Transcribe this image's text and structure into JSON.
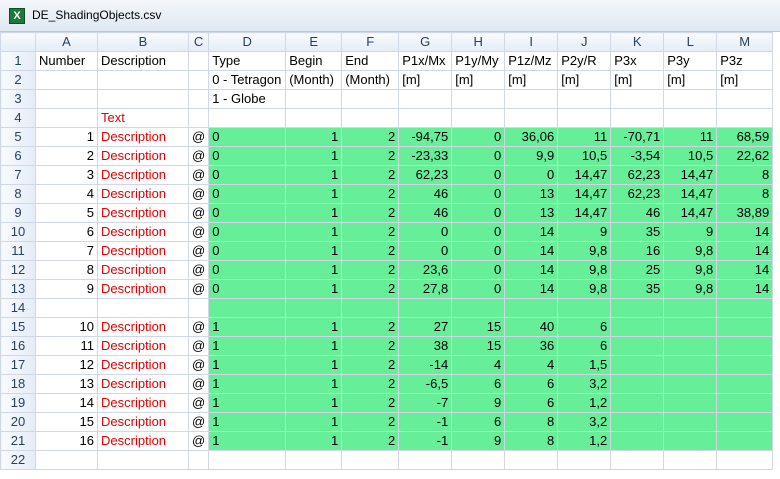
{
  "window": {
    "title": "DE_ShadingObjects.csv",
    "icon": "excel-icon"
  },
  "colors": {
    "fill": "#66ee99",
    "red_text": "#e00000"
  },
  "columns": [
    "A",
    "B",
    "C",
    "D",
    "E",
    "F",
    "G",
    "H",
    "I",
    "J",
    "K",
    "L",
    "M"
  ],
  "rows": [
    {
      "n": "1",
      "cells": [
        "Number",
        "Description",
        "",
        "Type",
        "Begin",
        "End",
        "P1x/Mx",
        "P1y/My",
        "P1z/Mz",
        "P2y/R",
        "P3x",
        "P3y",
        "P3z"
      ]
    },
    {
      "n": "2",
      "cells": [
        "",
        "",
        "",
        "0 - Tetragon",
        "(Month)",
        "(Month)",
        "[m]",
        "[m]",
        "[m]",
        "[m]",
        "[m]",
        "[m]",
        "[m]"
      ]
    },
    {
      "n": "3",
      "cells": [
        "",
        "",
        "",
        "1 - Globe",
        "",
        "",
        "",
        "",
        "",
        "",
        "",
        "",
        ""
      ]
    },
    {
      "n": "4",
      "cells": [
        "",
        "Text",
        "",
        "",
        "",
        "",
        "",
        "",
        "",
        "",
        "",
        "",
        ""
      ]
    },
    {
      "n": "5",
      "cells": [
        "1",
        "Description",
        "@",
        "0",
        "1",
        "2",
        "-94,75",
        "0",
        "36,06",
        "11",
        "-70,71",
        "11",
        "68,59"
      ]
    },
    {
      "n": "6",
      "cells": [
        "2",
        "Description",
        "@",
        "0",
        "1",
        "2",
        "-23,33",
        "0",
        "9,9",
        "10,5",
        "-3,54",
        "10,5",
        "22,62"
      ]
    },
    {
      "n": "7",
      "cells": [
        "3",
        "Description",
        "@",
        "0",
        "1",
        "2",
        "62,23",
        "0",
        "0",
        "14,47",
        "62,23",
        "14,47",
        "8"
      ]
    },
    {
      "n": "8",
      "cells": [
        "4",
        "Description",
        "@",
        "0",
        "1",
        "2",
        "46",
        "0",
        "13",
        "14,47",
        "62,23",
        "14,47",
        "8"
      ]
    },
    {
      "n": "9",
      "cells": [
        "5",
        "Description",
        "@",
        "0",
        "1",
        "2",
        "46",
        "0",
        "13",
        "14,47",
        "46",
        "14,47",
        "38,89"
      ]
    },
    {
      "n": "10",
      "cells": [
        "6",
        "Description",
        "@",
        "0",
        "1",
        "2",
        "0",
        "0",
        "14",
        "9",
        "35",
        "9",
        "14"
      ]
    },
    {
      "n": "11",
      "cells": [
        "7",
        "Description",
        "@",
        "0",
        "1",
        "2",
        "0",
        "0",
        "14",
        "9,8",
        "16",
        "9,8",
        "14"
      ]
    },
    {
      "n": "12",
      "cells": [
        "8",
        "Description",
        "@",
        "0",
        "1",
        "2",
        "23,6",
        "0",
        "14",
        "9,8",
        "25",
        "9,8",
        "14"
      ]
    },
    {
      "n": "13",
      "cells": [
        "9",
        "Description",
        "@",
        "0",
        "1",
        "2",
        "27,8",
        "0",
        "14",
        "9,8",
        "35",
        "9,8",
        "14"
      ]
    },
    {
      "n": "14",
      "cells": [
        "",
        "",
        "",
        "",
        "",
        "",
        "",
        "",
        "",
        "",
        "",
        "",
        ""
      ]
    },
    {
      "n": "15",
      "cells": [
        "10",
        "Description",
        "@",
        "1",
        "1",
        "2",
        "27",
        "15",
        "40",
        "6",
        "",
        "",
        ""
      ]
    },
    {
      "n": "16",
      "cells": [
        "11",
        "Description",
        "@",
        "1",
        "1",
        "2",
        "38",
        "15",
        "36",
        "6",
        "",
        "",
        ""
      ]
    },
    {
      "n": "17",
      "cells": [
        "12",
        "Description",
        "@",
        "1",
        "1",
        "2",
        "-14",
        "4",
        "4",
        "1,5",
        "",
        "",
        ""
      ]
    },
    {
      "n": "18",
      "cells": [
        "13",
        "Description",
        "@",
        "1",
        "1",
        "2",
        "-6,5",
        "6",
        "6",
        "3,2",
        "",
        "",
        ""
      ]
    },
    {
      "n": "19",
      "cells": [
        "14",
        "Description",
        "@",
        "1",
        "1",
        "2",
        "-7",
        "9",
        "6",
        "1,2",
        "",
        "",
        ""
      ]
    },
    {
      "n": "20",
      "cells": [
        "15",
        "Description",
        "@",
        "1",
        "1",
        "2",
        "-1",
        "6",
        "8",
        "3,2",
        "",
        "",
        ""
      ]
    },
    {
      "n": "21",
      "cells": [
        "16",
        "Description",
        "@",
        "1",
        "1",
        "2",
        "-1",
        "9",
        "8",
        "1,2",
        "",
        "",
        ""
      ]
    },
    {
      "n": "22",
      "cells": [
        "",
        "",
        "",
        "",
        "",
        "",
        "",
        "",
        "",
        "",
        "",
        "",
        ""
      ]
    }
  ]
}
